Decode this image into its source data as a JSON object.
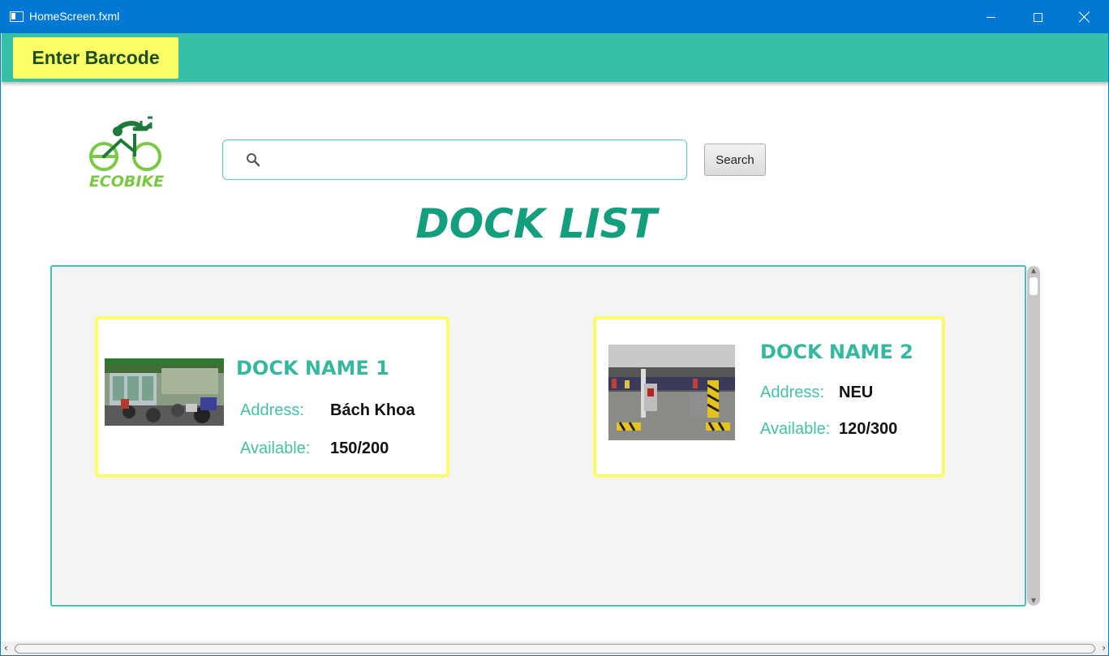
{
  "window": {
    "title": "HomeScreen.fxml",
    "accent": "#0078d4"
  },
  "toolbar": {
    "enter_barcode_label": "Enter Barcode",
    "background": "#36c0a8",
    "button_color": "#fdfd66"
  },
  "logo": {
    "text": "ECOBIKE"
  },
  "search": {
    "value": "",
    "placeholder": "",
    "button_label": "Search"
  },
  "page_title": "DOCK LIST",
  "docks": [
    {
      "name": "DOCK NAME 1",
      "address_label": "Address:",
      "address": "Bách Khoa",
      "available_label": "Available:",
      "available": "150/200"
    },
    {
      "name": "DOCK NAME 2",
      "address_label": "Address:",
      "address": "NEU",
      "available_label": "Available:",
      "available": "120/300"
    }
  ],
  "icons": {
    "window_app": "window-app-icon",
    "minimize": "minimize-icon",
    "maximize": "maximize-icon",
    "close": "close-icon",
    "search": "search-icon"
  }
}
